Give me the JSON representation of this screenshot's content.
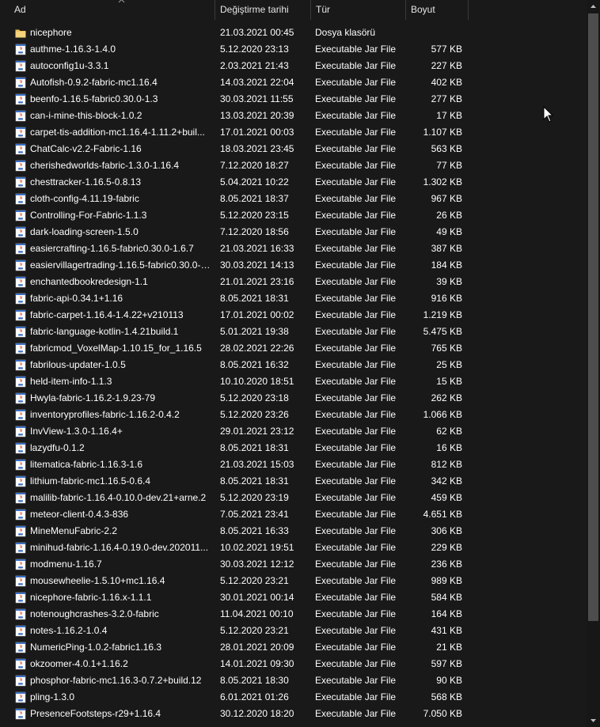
{
  "columns": {
    "name": "Ad",
    "date": "Değiştirme tarihi",
    "type": "Tür",
    "size": "Boyut"
  },
  "colors": {
    "background": "#191919",
    "folder": "#e8c15b",
    "jar_icon": "#ffffff",
    "scroll_thumb": "#4d4d4d"
  },
  "files": [
    {
      "icon": "folder-icon",
      "name": "nicephore",
      "date": "21.03.2021 00:45",
      "type": "Dosya klasörü",
      "size": ""
    },
    {
      "icon": "jar-file-icon",
      "name": "authme-1.16.3-1.4.0",
      "date": "5.12.2020 23:13",
      "type": "Executable Jar File",
      "size": "577 KB"
    },
    {
      "icon": "jar-file-icon",
      "name": "autoconfig1u-3.3.1",
      "date": "2.03.2021 21:43",
      "type": "Executable Jar File",
      "size": "227 KB"
    },
    {
      "icon": "jar-file-icon",
      "name": "Autofish-0.9.2-fabric-mc1.16.4",
      "date": "14.03.2021 22:04",
      "type": "Executable Jar File",
      "size": "402 KB"
    },
    {
      "icon": "jar-file-icon",
      "name": "beenfo-1.16.5-fabric0.30.0-1.3",
      "date": "30.03.2021 11:55",
      "type": "Executable Jar File",
      "size": "277 KB"
    },
    {
      "icon": "jar-file-icon",
      "name": "can-i-mine-this-block-1.0.2",
      "date": "13.03.2021 20:39",
      "type": "Executable Jar File",
      "size": "17 KB"
    },
    {
      "icon": "jar-file-icon",
      "name": "carpet-tis-addition-mc1.16.4-1.11.2+buil...",
      "date": "17.01.2021 00:03",
      "type": "Executable Jar File",
      "size": "1.107 KB"
    },
    {
      "icon": "jar-file-icon",
      "name": "ChatCalc-v2.2-Fabric-1.16",
      "date": "18.03.2021 23:45",
      "type": "Executable Jar File",
      "size": "563 KB"
    },
    {
      "icon": "jar-file-icon",
      "name": "cherishedworlds-fabric-1.3.0-1.16.4",
      "date": "7.12.2020 18:27",
      "type": "Executable Jar File",
      "size": "77 KB"
    },
    {
      "icon": "jar-file-icon",
      "name": "chesttracker-1.16.5-0.8.13",
      "date": "5.04.2021 10:22",
      "type": "Executable Jar File",
      "size": "1.302 KB"
    },
    {
      "icon": "jar-file-icon",
      "name": "cloth-config-4.11.19-fabric",
      "date": "8.05.2021 18:37",
      "type": "Executable Jar File",
      "size": "967 KB"
    },
    {
      "icon": "jar-file-icon",
      "name": "Controlling-For-Fabric-1.1.3",
      "date": "5.12.2020 23:15",
      "type": "Executable Jar File",
      "size": "26 KB"
    },
    {
      "icon": "jar-file-icon",
      "name": "dark-loading-screen-1.5.0",
      "date": "7.12.2020 18:56",
      "type": "Executable Jar File",
      "size": "49 KB"
    },
    {
      "icon": "jar-file-icon",
      "name": "easiercrafting-1.16.5-fabric0.30.0-1.6.7",
      "date": "21.03.2021 16:33",
      "type": "Executable Jar File",
      "size": "387 KB"
    },
    {
      "icon": "jar-file-icon",
      "name": "easiervillagertrading-1.16.5-fabric0.30.0-1...",
      "date": "30.03.2021 14:13",
      "type": "Executable Jar File",
      "size": "184 KB"
    },
    {
      "icon": "jar-file-icon",
      "name": "enchantedbookredesign-1.1",
      "date": "21.01.2021 23:16",
      "type": "Executable Jar File",
      "size": "39 KB"
    },
    {
      "icon": "jar-file-icon",
      "name": "fabric-api-0.34.1+1.16",
      "date": "8.05.2021 18:31",
      "type": "Executable Jar File",
      "size": "916 KB"
    },
    {
      "icon": "jar-file-icon",
      "name": "fabric-carpet-1.16.4-1.4.22+v210113",
      "date": "17.01.2021 00:02",
      "type": "Executable Jar File",
      "size": "1.219 KB"
    },
    {
      "icon": "jar-file-icon",
      "name": "fabric-language-kotlin-1.4.21build.1",
      "date": "5.01.2021 19:38",
      "type": "Executable Jar File",
      "size": "5.475 KB"
    },
    {
      "icon": "jar-file-icon",
      "name": "fabricmod_VoxelMap-1.10.15_for_1.16.5",
      "date": "28.02.2021 22:26",
      "type": "Executable Jar File",
      "size": "765 KB"
    },
    {
      "icon": "jar-file-icon",
      "name": "fabrilous-updater-1.0.5",
      "date": "8.05.2021 16:32",
      "type": "Executable Jar File",
      "size": "25 KB"
    },
    {
      "icon": "jar-file-icon",
      "name": "held-item-info-1.1.3",
      "date": "10.10.2020 18:51",
      "type": "Executable Jar File",
      "size": "15 KB"
    },
    {
      "icon": "jar-file-icon",
      "name": "Hwyla-fabric-1.16.2-1.9.23-79",
      "date": "5.12.2020 23:18",
      "type": "Executable Jar File",
      "size": "262 KB"
    },
    {
      "icon": "jar-file-icon",
      "name": "inventoryprofiles-fabric-1.16.2-0.4.2",
      "date": "5.12.2020 23:26",
      "type": "Executable Jar File",
      "size": "1.066 KB"
    },
    {
      "icon": "jar-file-icon",
      "name": "InvView-1.3.0-1.16.4+",
      "date": "29.01.2021 23:12",
      "type": "Executable Jar File",
      "size": "62 KB"
    },
    {
      "icon": "jar-file-icon",
      "name": "lazydfu-0.1.2",
      "date": "8.05.2021 18:31",
      "type": "Executable Jar File",
      "size": "16 KB"
    },
    {
      "icon": "jar-file-icon",
      "name": "litematica-fabric-1.16.3-1.6",
      "date": "21.03.2021 15:03",
      "type": "Executable Jar File",
      "size": "812 KB"
    },
    {
      "icon": "jar-file-icon",
      "name": "lithium-fabric-mc1.16.5-0.6.4",
      "date": "8.05.2021 18:31",
      "type": "Executable Jar File",
      "size": "342 KB"
    },
    {
      "icon": "jar-file-icon",
      "name": "malilib-fabric-1.16.4-0.10.0-dev.21+arne.2",
      "date": "5.12.2020 23:19",
      "type": "Executable Jar File",
      "size": "459 KB"
    },
    {
      "icon": "jar-file-icon",
      "name": "meteor-client-0.4.3-836",
      "date": "7.05.2021 23:41",
      "type": "Executable Jar File",
      "size": "4.651 KB"
    },
    {
      "icon": "jar-file-icon",
      "name": "MineMenuFabric-2.2",
      "date": "8.05.2021 16:33",
      "type": "Executable Jar File",
      "size": "306 KB"
    },
    {
      "icon": "jar-file-icon",
      "name": "minihud-fabric-1.16.4-0.19.0-dev.202011...",
      "date": "10.02.2021 19:51",
      "type": "Executable Jar File",
      "size": "229 KB"
    },
    {
      "icon": "jar-file-icon",
      "name": "modmenu-1.16.7",
      "date": "30.03.2021 12:12",
      "type": "Executable Jar File",
      "size": "236 KB"
    },
    {
      "icon": "jar-file-icon",
      "name": "mousewheelie-1.5.10+mc1.16.4",
      "date": "5.12.2020 23:21",
      "type": "Executable Jar File",
      "size": "989 KB"
    },
    {
      "icon": "jar-file-icon",
      "name": "nicephore-fabric-1.16.x-1.1.1",
      "date": "30.01.2021 00:14",
      "type": "Executable Jar File",
      "size": "584 KB"
    },
    {
      "icon": "jar-file-icon",
      "name": "notenoughcrashes-3.2.0-fabric",
      "date": "11.04.2021 00:10",
      "type": "Executable Jar File",
      "size": "164 KB"
    },
    {
      "icon": "jar-file-icon",
      "name": "notes-1.16.2-1.0.4",
      "date": "5.12.2020 23:21",
      "type": "Executable Jar File",
      "size": "431 KB"
    },
    {
      "icon": "jar-file-icon",
      "name": "NumericPing-1.0.2-fabric1.16.3",
      "date": "28.01.2021 20:09",
      "type": "Executable Jar File",
      "size": "21 KB"
    },
    {
      "icon": "jar-file-icon",
      "name": "okzoomer-4.0.1+1.16.2",
      "date": "14.01.2021 09:30",
      "type": "Executable Jar File",
      "size": "597 KB"
    },
    {
      "icon": "jar-file-icon",
      "name": "phosphor-fabric-mc1.16.3-0.7.2+build.12",
      "date": "8.05.2021 18:30",
      "type": "Executable Jar File",
      "size": "90 KB"
    },
    {
      "icon": "jar-file-icon",
      "name": "pling-1.3.0",
      "date": "6.01.2021 01:26",
      "type": "Executable Jar File",
      "size": "568 KB"
    },
    {
      "icon": "jar-file-icon",
      "name": "PresenceFootsteps-r29+1.16.4",
      "date": "30.12.2020 18:20",
      "type": "Executable Jar File",
      "size": "7.050 KB"
    }
  ]
}
